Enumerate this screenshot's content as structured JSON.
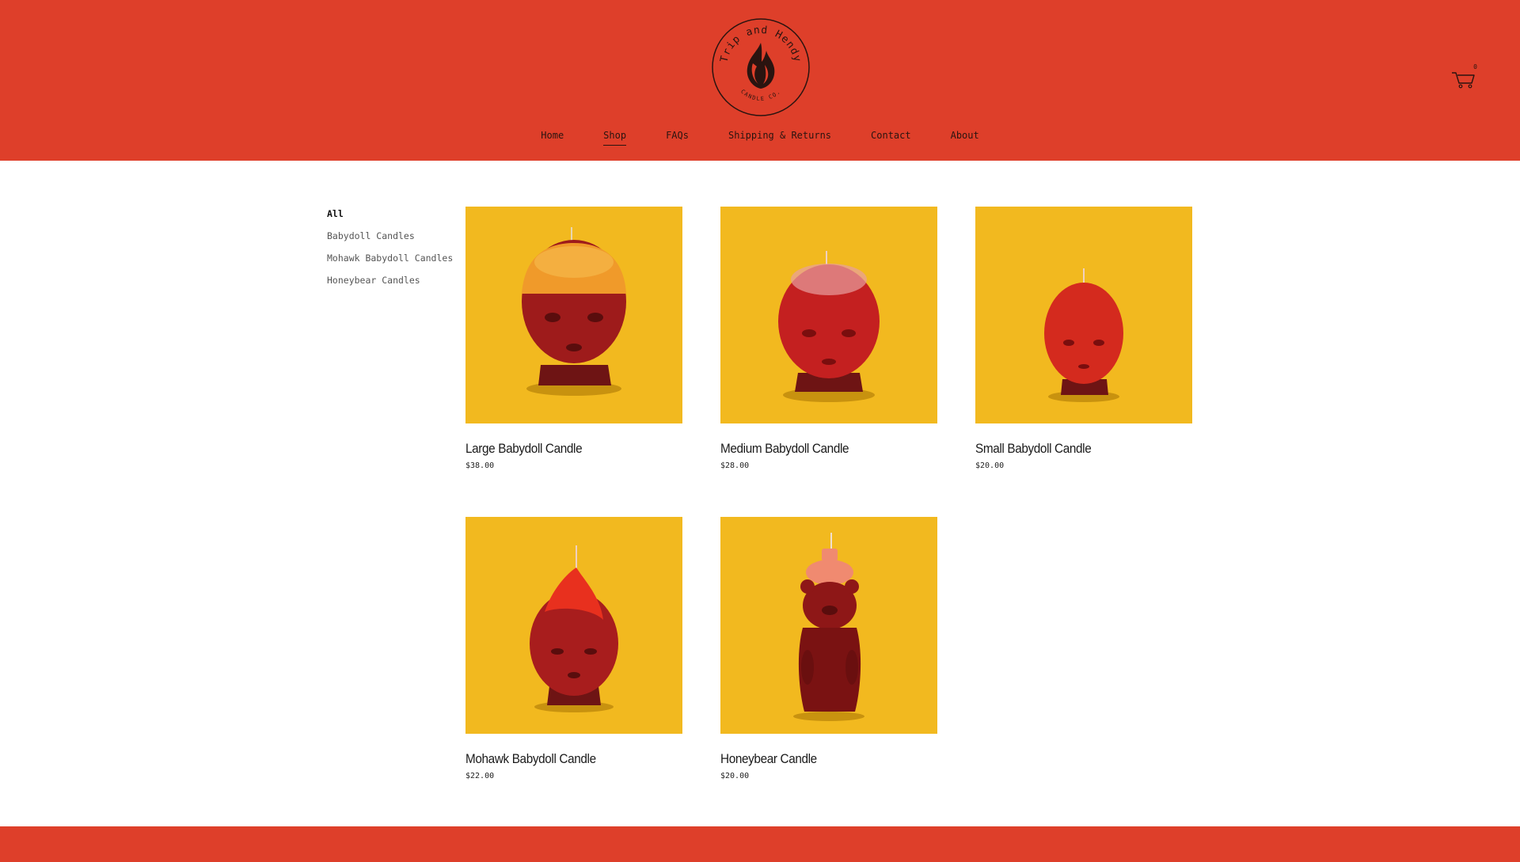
{
  "brand": {
    "name_top": "Trip and Hendy",
    "name_bottom": "CANDLE CO.",
    "accent_color": "#de3f2a",
    "product_bg_color": "#f2b91f"
  },
  "nav": {
    "items": [
      {
        "label": "Home"
      },
      {
        "label": "Shop",
        "active": true
      },
      {
        "label": "FAQs"
      },
      {
        "label": "Shipping & Returns"
      },
      {
        "label": "Contact"
      },
      {
        "label": "About"
      }
    ]
  },
  "cart": {
    "icon": "cart-icon",
    "count": "0"
  },
  "sidebar": {
    "categories": [
      {
        "label": "All",
        "active": true
      },
      {
        "label": "Babydoll Candles"
      },
      {
        "label": "Mohawk Babydoll Candles"
      },
      {
        "label": "Honeybear Candles"
      }
    ]
  },
  "products": [
    {
      "title": "Large Babydoll Candle",
      "price": "$38.00",
      "image": "large-babydoll-candle-image"
    },
    {
      "title": "Medium Babydoll Candle",
      "price": "$28.00",
      "image": "medium-babydoll-candle-image"
    },
    {
      "title": "Small Babydoll Candle",
      "price": "$20.00",
      "image": "small-babydoll-candle-image"
    },
    {
      "title": "Mohawk Babydoll Candle",
      "price": "$22.00",
      "image": "mohawk-babydoll-candle-image"
    },
    {
      "title": "Honeybear Candle",
      "price": "$20.00",
      "image": "honeybear-candle-image"
    }
  ]
}
